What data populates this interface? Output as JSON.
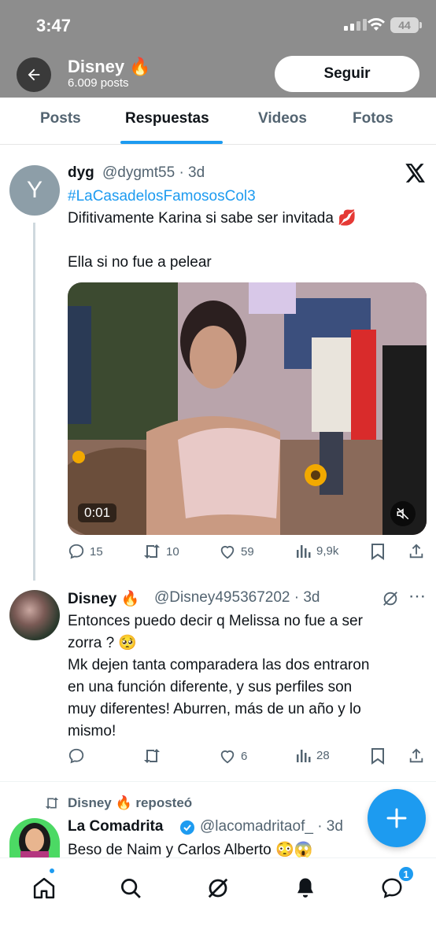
{
  "status_bar": {
    "time": "3:47",
    "battery": "44"
  },
  "header": {
    "title": "Disney 🔥",
    "subtitle": "6.009 posts",
    "follow_label": "Seguir"
  },
  "tabs": [
    {
      "label": "Posts",
      "active": false
    },
    {
      "label": "Respuestas",
      "active": true
    },
    {
      "label": "Videos",
      "active": false
    },
    {
      "label": "Fotos",
      "active": false
    }
  ],
  "tweet1": {
    "avatar_letter": "Y",
    "name": "dyg",
    "handle": "@dygmt55 · 3d",
    "hashtag": "#LaCasadelosFamososCol3",
    "line1": "Difitivamente Karina si sabe ser invitada 💋",
    "line2": "Ella si no fue a pelear",
    "video_time": "0:01",
    "replies": "15",
    "reposts": "10",
    "likes": "59",
    "views": "9,9k"
  },
  "tweet2": {
    "name": "Disney 🔥",
    "handle": "@Disney495367202 · 3d",
    "lines": [
      "Entonces puedo decir q Melissa no fue a ser",
      "zorra ? 🥺",
      "Mk dejen tanta comparadera las dos entraron",
      "en una función diferente, y sus perfiles son",
      "muy diferentes! Aburren, más de un año y lo",
      "mismo!"
    ],
    "replies": "",
    "reposts": "",
    "likes": "6",
    "views": "28"
  },
  "repost_label": "Disney 🔥 reposteó",
  "tweet3": {
    "name": "La Comadrita",
    "handle": "@lacomadritaof_ · 3d",
    "line1": "Beso de Naim y Carlos Alberto 😳😱"
  },
  "bottom_nav": {
    "messages_badge": "1"
  },
  "colors": {
    "accent": "#1d9bf0",
    "banner": "#8d8d8d",
    "muted": "#536471"
  }
}
